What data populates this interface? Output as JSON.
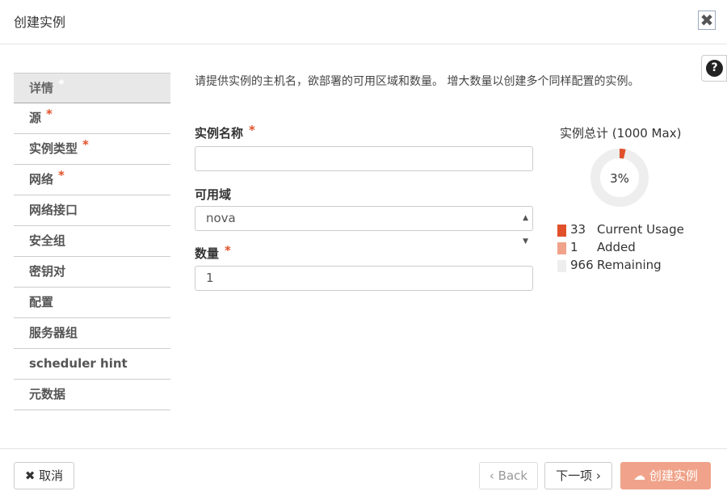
{
  "dialog": {
    "title": "创建实例",
    "close_icon": "close-icon",
    "help_icon": "question-icon"
  },
  "nav": {
    "items": [
      {
        "label": "详情",
        "required": true,
        "active": true
      },
      {
        "label": "源",
        "required": true
      },
      {
        "label": "实例类型",
        "required": true
      },
      {
        "label": "网络",
        "required": true
      },
      {
        "label": "网络接口"
      },
      {
        "label": "安全组"
      },
      {
        "label": "密钥对"
      },
      {
        "label": "配置"
      },
      {
        "label": "服务器组"
      },
      {
        "label": "scheduler hint"
      },
      {
        "label": "元数据"
      }
    ],
    "required_mark": "*"
  },
  "form": {
    "description": "请提供实例的主机名，欲部署的可用区域和数量。 增大数量以创建多个同样配置的实例。",
    "instance_name": {
      "label": "实例名称",
      "value": ""
    },
    "availability_zone": {
      "label": "可用域",
      "value": "nova"
    },
    "count": {
      "label": "数量",
      "value": "1"
    }
  },
  "quota": {
    "title": "实例总计 (1000 Max)",
    "percent_label": "3%",
    "used_fraction": 0.034,
    "legend": [
      {
        "num": "33",
        "text": "Current Usage",
        "color": "#e0512a"
      },
      {
        "num": "1",
        "text": "Added",
        "color": "#f0a38a"
      },
      {
        "num": "966",
        "text": "Remaining",
        "color": "#eeeeee"
      }
    ]
  },
  "footer": {
    "cancel": "取消",
    "back": "Back",
    "next": "下一项",
    "create": "创建实例"
  },
  "colors": {
    "accent": "#e0512a",
    "primary_button": "#f0a38a"
  }
}
